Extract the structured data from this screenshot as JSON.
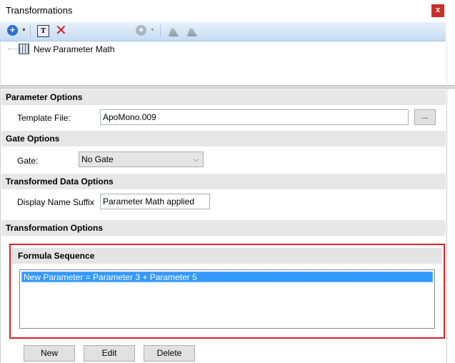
{
  "window": {
    "title": "Transformations",
    "close_label": "x"
  },
  "toolbar": {
    "icons": [
      "add-icon",
      "text-icon",
      "delete-icon",
      "add-disabled-icon",
      "gate-icon",
      "gate-alt-icon"
    ]
  },
  "tree": {
    "items": [
      {
        "label": "New Parameter Math"
      }
    ]
  },
  "sections": {
    "parameter_options": {
      "title": "Parameter Options",
      "template_label": "Template File:",
      "template_value": "ApoMono.009",
      "browse_label": "..."
    },
    "gate_options": {
      "title": "Gate Options",
      "gate_label": "Gate:",
      "gate_value": "No Gate"
    },
    "transformed_data_options": {
      "title": "Transformed Data Options",
      "suffix_label": "Display Name Suffix",
      "suffix_value": "Parameter Math applied"
    },
    "transformation_options": {
      "title": "Transformation Options"
    }
  },
  "formula_sequence": {
    "title": "Formula Sequence",
    "items": [
      "New Parameter = Parameter 3 + Parameter 5"
    ]
  },
  "buttons": {
    "new": "New",
    "edit": "Edit",
    "delete": "Delete"
  },
  "colors": {
    "highlight": "#d4232b",
    "selection": "#3399ff"
  }
}
